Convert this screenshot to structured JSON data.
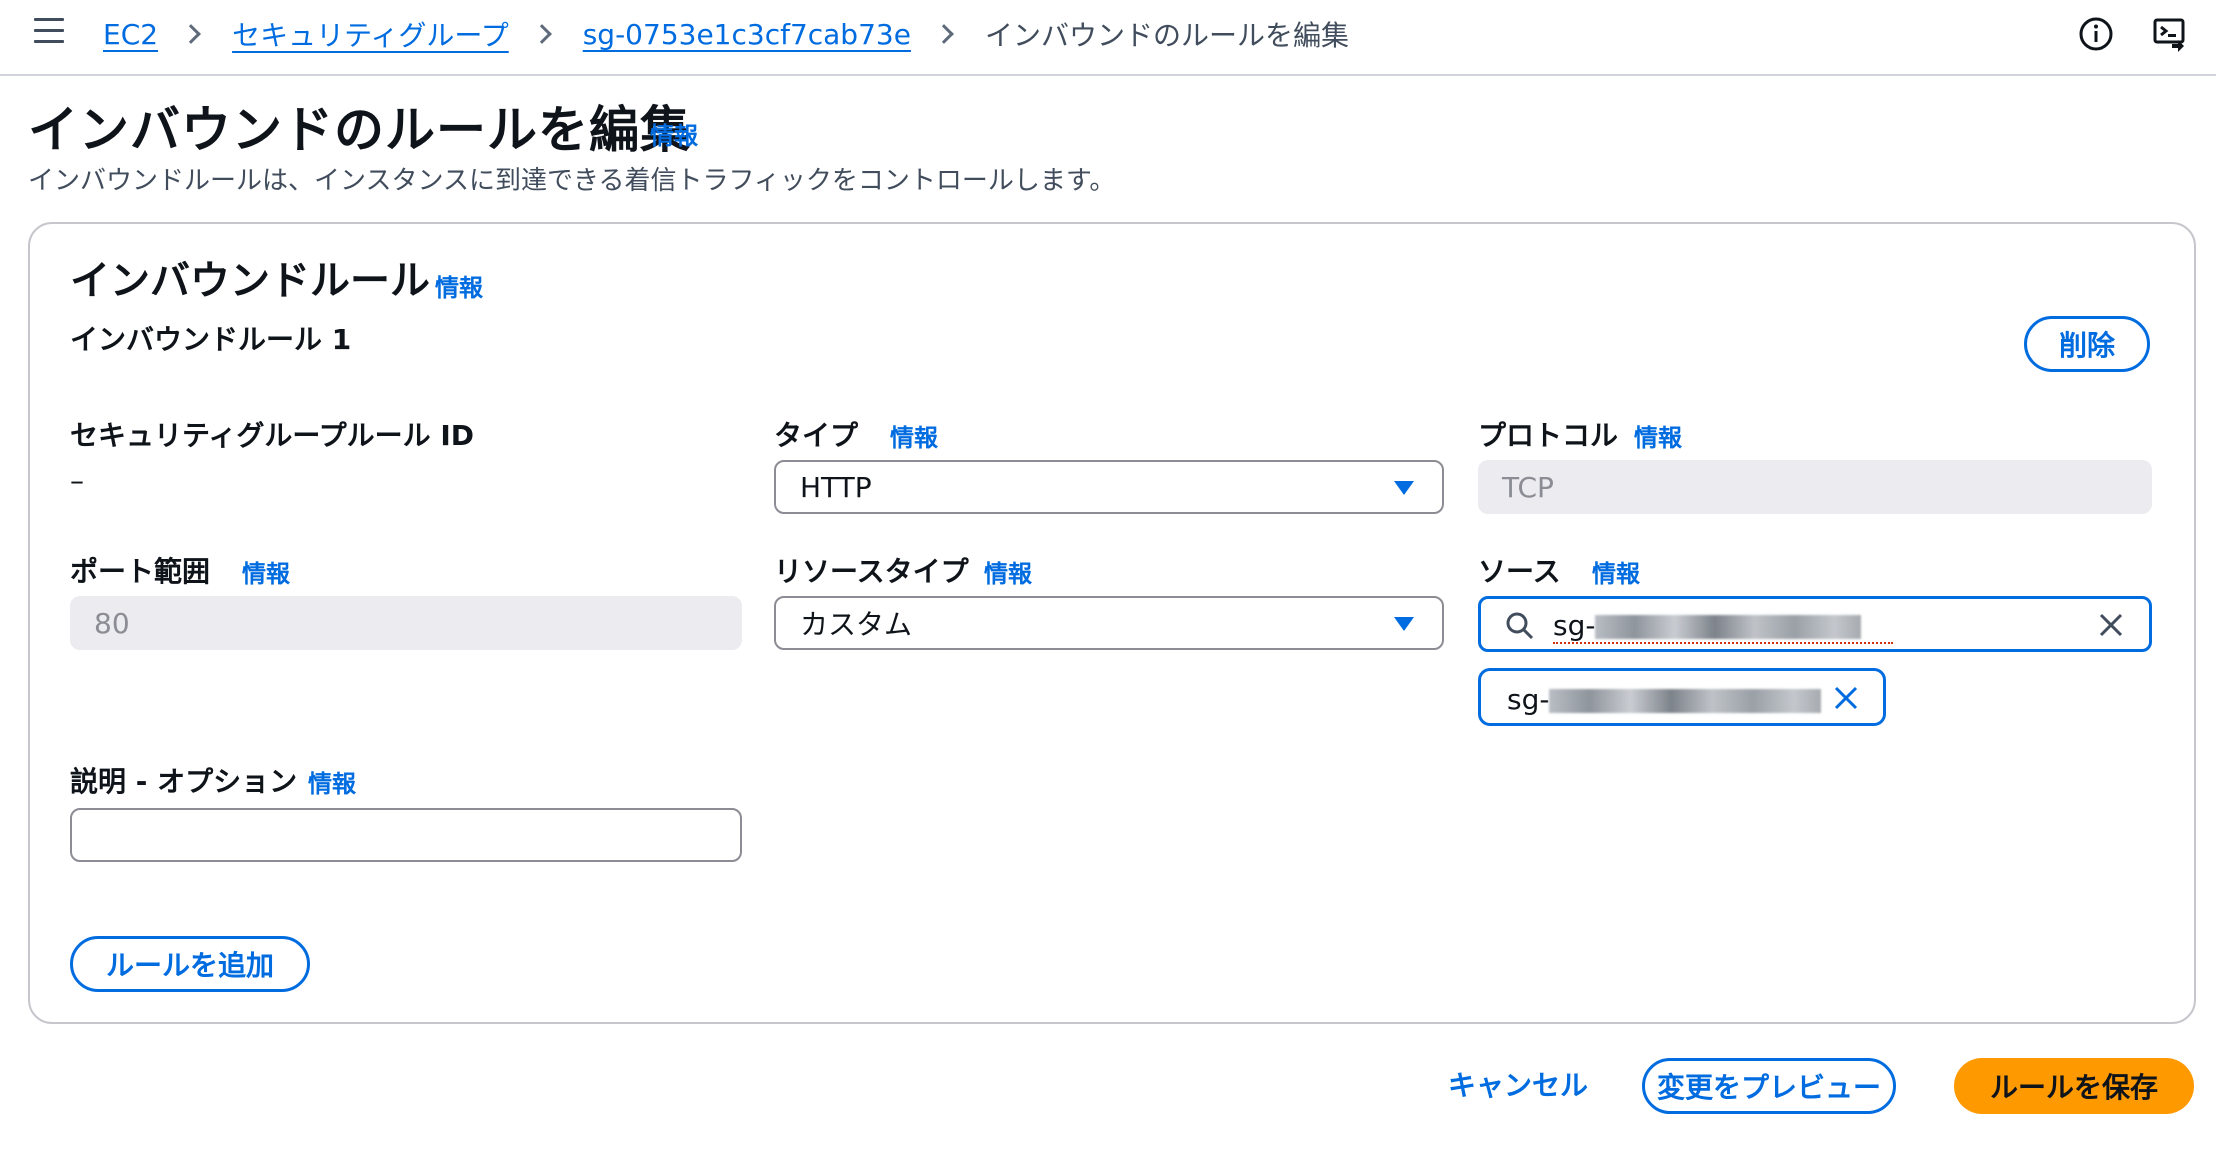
{
  "breadcrumb": {
    "items": [
      "EC2",
      "セキュリティグループ",
      "sg-0753e1c3cf7cab73e"
    ],
    "current": "インバウンドのルールを編集"
  },
  "header": {
    "title": "インバウンドのルールを編集",
    "info": "情報",
    "description": "インバウンドルールは、インスタンスに到達できる着信トラフィックをコントロールします。"
  },
  "panel": {
    "title": "インバウンドルール",
    "info": "情報",
    "rule_title": "インバウンドルール 1",
    "delete_label": "削除",
    "add_rule_label": "ルールを追加"
  },
  "fields": {
    "sg_rule_id": {
      "label": "セキュリティグループルール ID",
      "value": "–"
    },
    "type": {
      "label": "タイプ",
      "info": "情報",
      "value": "HTTP"
    },
    "protocol": {
      "label": "プロトコル",
      "info": "情報",
      "value": "TCP"
    },
    "port_range": {
      "label": "ポート範囲",
      "info": "情報",
      "value": "80"
    },
    "resource_type": {
      "label": "リソースタイプ",
      "info": "情報",
      "value": "カスタム"
    },
    "source": {
      "label": "ソース",
      "info": "情報",
      "search_prefix": "sg-",
      "token_prefix": "sg-"
    },
    "description": {
      "label": "説明 - オプション",
      "info": "情報",
      "value": ""
    }
  },
  "footer": {
    "cancel_label": "キャンセル",
    "preview_label": "変更をプレビュー",
    "save_label": "ルールを保存"
  },
  "colors": {
    "link": "#006ce0",
    "primary_button": "#ff9900",
    "disabled_bg": "#ebebf0"
  }
}
